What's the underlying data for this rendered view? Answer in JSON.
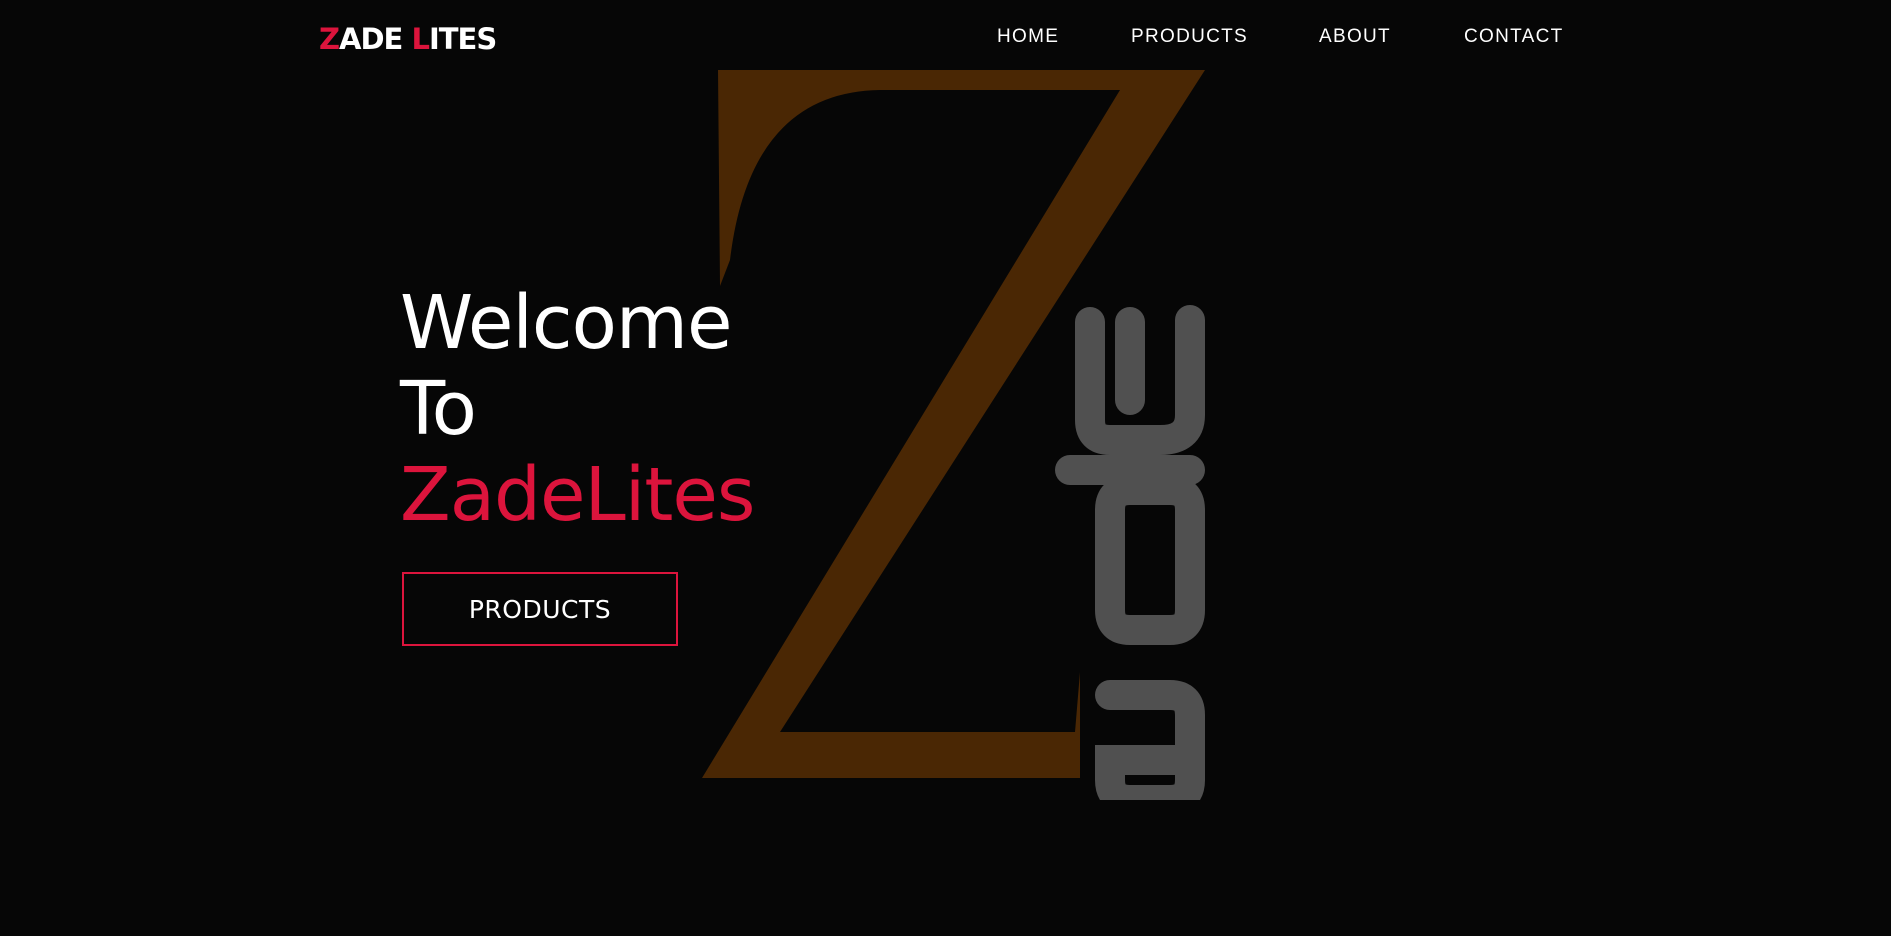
{
  "colors": {
    "background": "#060606",
    "accent": "#dc143c",
    "text": "#ffffff",
    "logo_z": "#4a2704",
    "logo_letters": "#505050"
  },
  "brand": {
    "first_initial": "Z",
    "first_rest": "ADE ",
    "second_initial": "L",
    "second_rest": "ITES"
  },
  "nav": {
    "items": [
      {
        "label": "HOME"
      },
      {
        "label": "PRODUCTS"
      },
      {
        "label": "ABOUT"
      },
      {
        "label": "CONTACT"
      }
    ]
  },
  "hero": {
    "line1": "Welcome",
    "line2": "To",
    "line3": "ZadeLites",
    "cta_label": "PRODUCTS"
  },
  "background_art": {
    "icon": "zade-logo-icon",
    "letters": "ade"
  }
}
